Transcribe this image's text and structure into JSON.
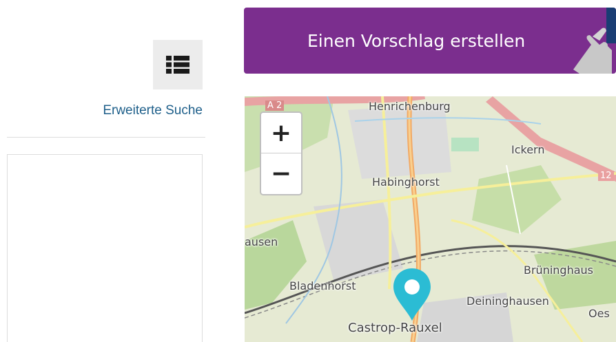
{
  "left": {
    "list_toggle_icon": "list-icon",
    "advanced_search": "Erweiterte Suche"
  },
  "cta": {
    "label": "Einen Vorschlag erstellen",
    "color": "#7b2e8e",
    "icon": "pointing-hand-icon"
  },
  "map": {
    "zoom_in": "+",
    "zoom_out": "−",
    "labels": {
      "henrichenburg": "Henrichenburg",
      "ickern": "Ickern",
      "habinghorst": "Habinghorst",
      "hausen": "ausen",
      "bruninghausen": "Brüninghaus",
      "bladenhorst": "Bladenhorst",
      "deininghausen": "Deininghausen",
      "castrop_rauxel": "Castrop-Rauxel",
      "oes": "Oes",
      "a2": "A 2",
      "road_12": "12"
    },
    "marker_icon": "map-pin-icon",
    "marker_color": "#2bbcd4"
  }
}
